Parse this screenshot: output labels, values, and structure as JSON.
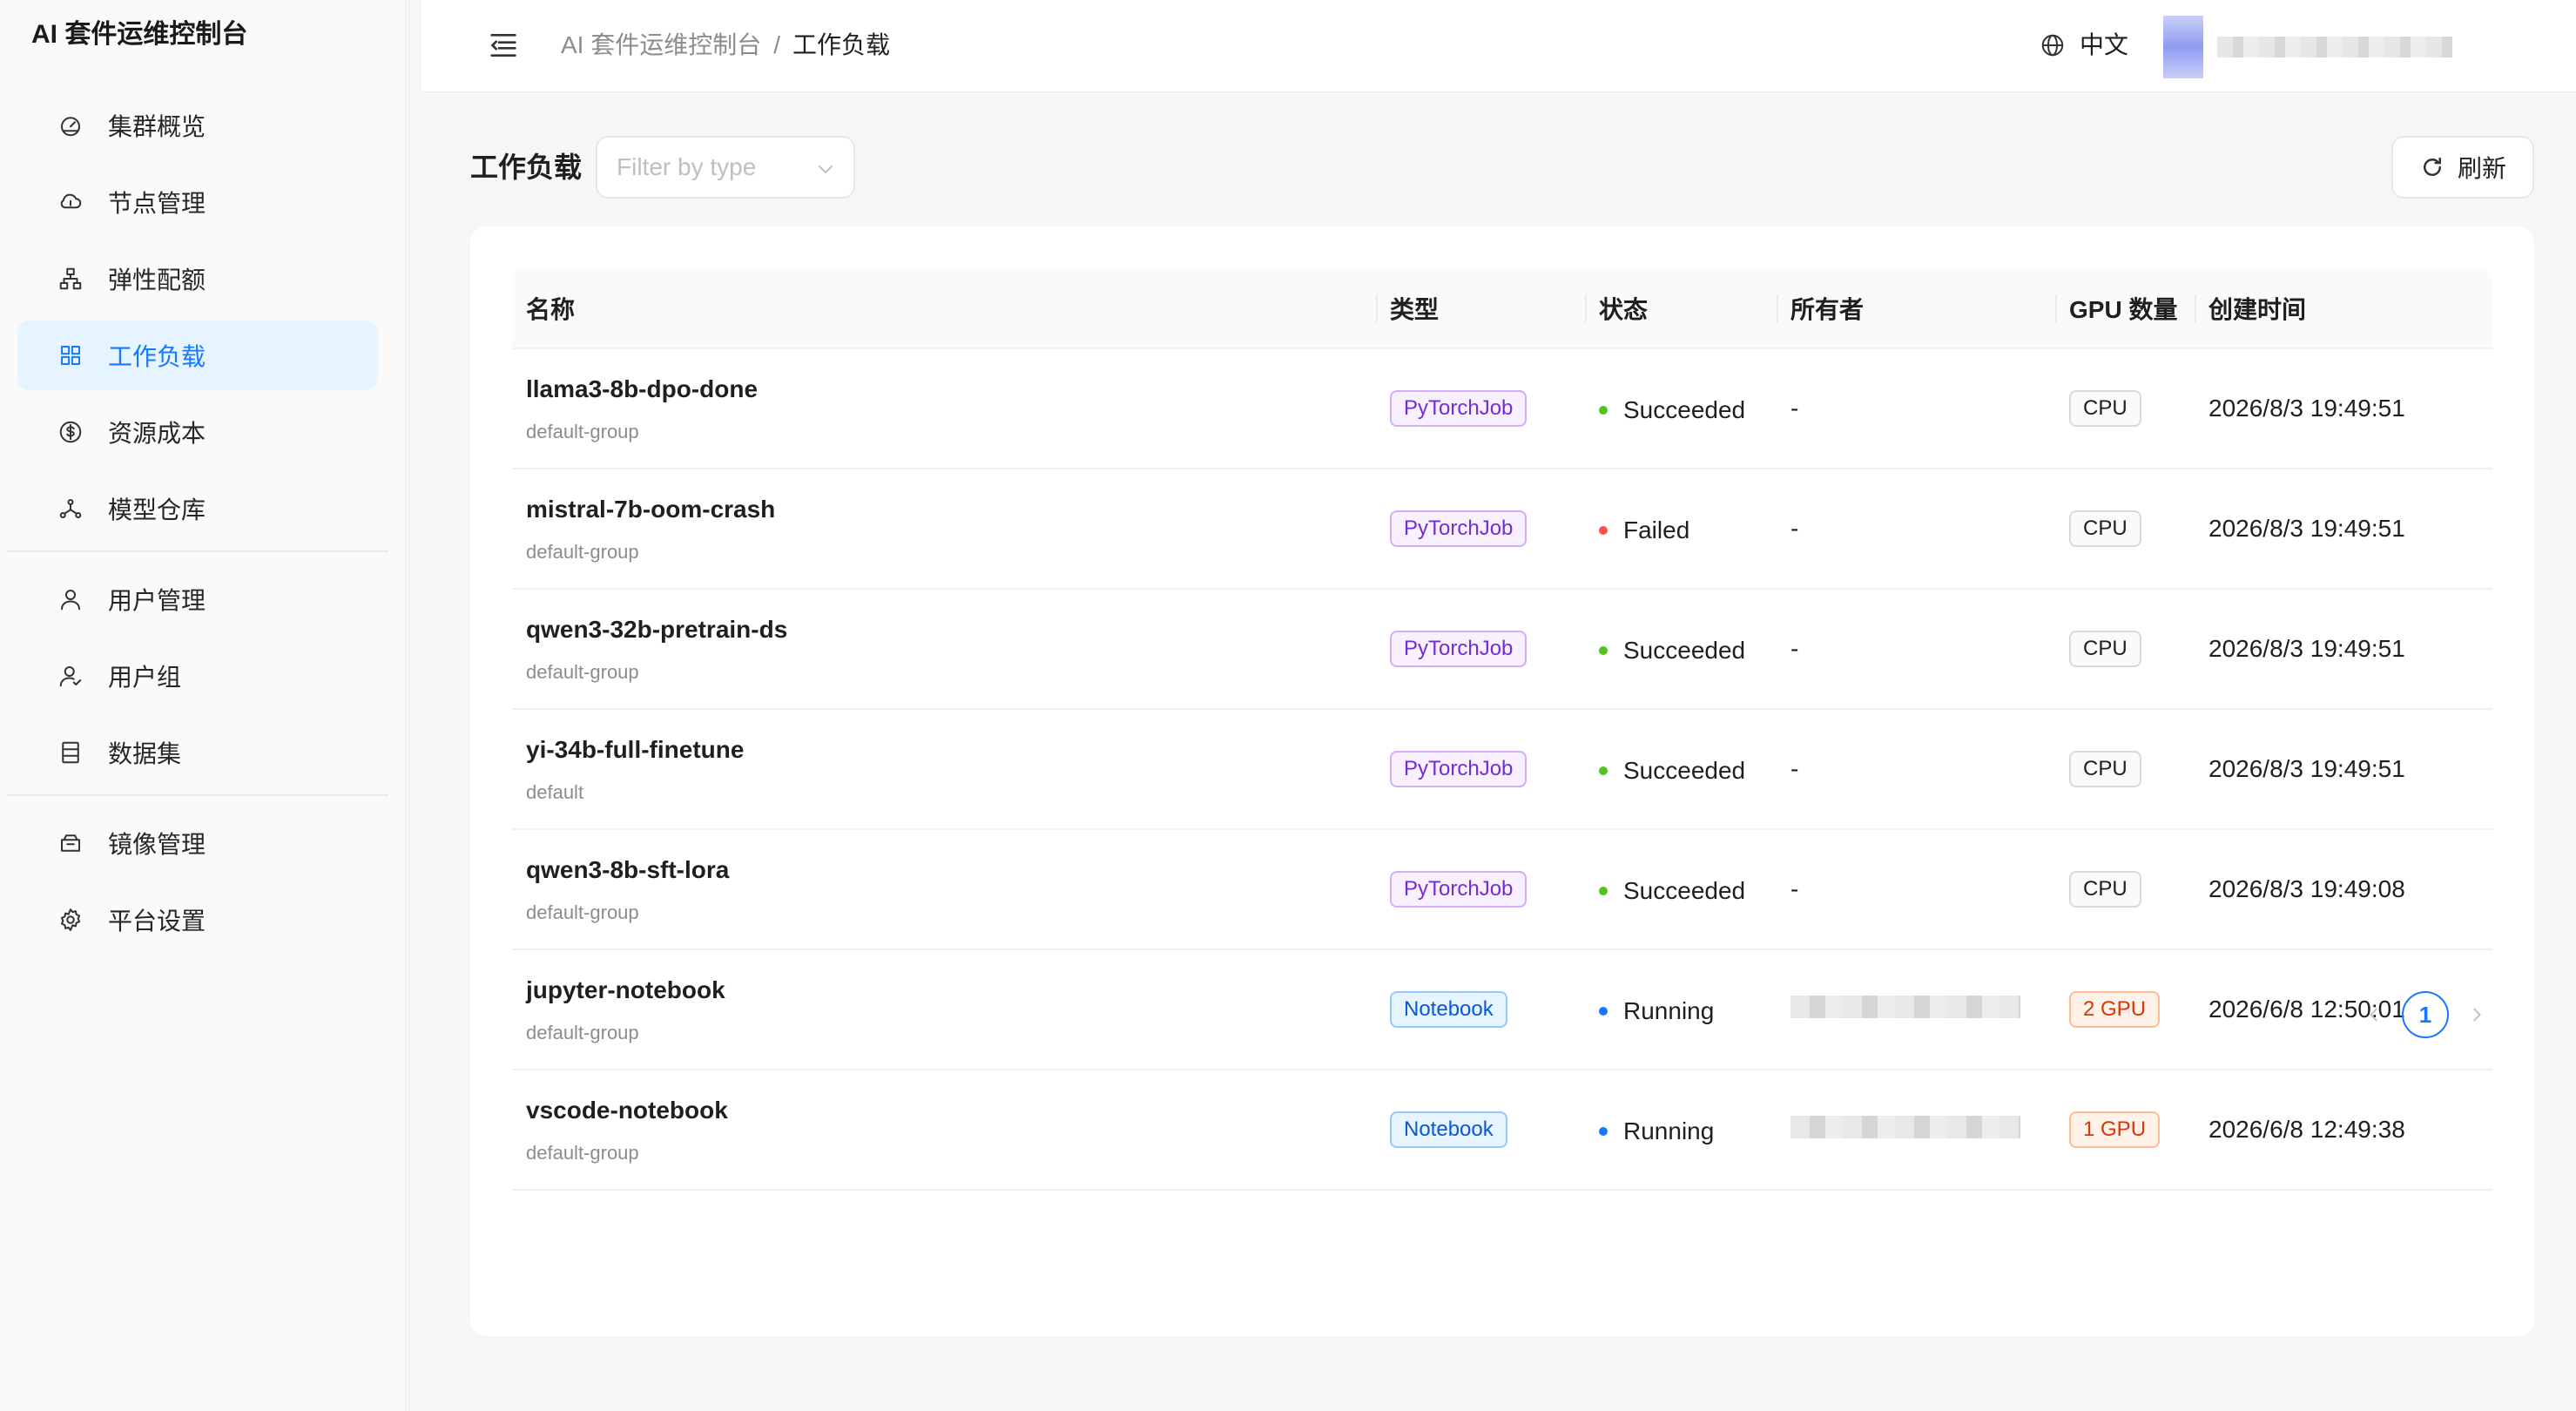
{
  "app": {
    "title": "AI 套件运维控制台"
  },
  "sidebar": {
    "groups": [
      [
        {
          "label": "集群概览",
          "icon": "dashboard-icon"
        },
        {
          "label": "节点管理",
          "icon": "cloud-icon"
        },
        {
          "label": "弹性配额",
          "icon": "hierarchy-icon"
        },
        {
          "label": "工作负载",
          "icon": "grid-icon",
          "active": true
        },
        {
          "label": "资源成本",
          "icon": "dollar-icon"
        },
        {
          "label": "模型仓库",
          "icon": "network-icon"
        }
      ],
      [
        {
          "label": "用户管理",
          "icon": "user-icon"
        },
        {
          "label": "用户组",
          "icon": "user-group-icon"
        },
        {
          "label": "数据集",
          "icon": "database-icon"
        }
      ],
      [
        {
          "label": "镜像管理",
          "icon": "box-icon"
        },
        {
          "label": "平台设置",
          "icon": "gear-icon"
        }
      ]
    ]
  },
  "header": {
    "breadcrumb": [
      "AI 套件运维控制台",
      "工作负载"
    ],
    "separator": "/",
    "language": "中文"
  },
  "toolbar": {
    "title": "工作负载",
    "filter_placeholder": "Filter by type",
    "refresh_label": "刷新"
  },
  "table": {
    "columns": [
      "名称",
      "类型",
      "状态",
      "所有者",
      "GPU 数量",
      "创建时间"
    ],
    "rows": [
      {
        "name": "llama3-8b-dpo-done",
        "group": "default-group",
        "type": "PyTorchJob",
        "status": "Succeeded",
        "owner": "-",
        "gpu": "CPU",
        "created": "2026/8/3 19:49:51"
      },
      {
        "name": "mistral-7b-oom-crash",
        "group": "default-group",
        "type": "PyTorchJob",
        "status": "Failed",
        "owner": "-",
        "gpu": "CPU",
        "created": "2026/8/3 19:49:51"
      },
      {
        "name": "qwen3-32b-pretrain-ds",
        "group": "default-group",
        "type": "PyTorchJob",
        "status": "Succeeded",
        "owner": "-",
        "gpu": "CPU",
        "created": "2026/8/3 19:49:51"
      },
      {
        "name": "yi-34b-full-finetune",
        "group": "default",
        "type": "PyTorchJob",
        "status": "Succeeded",
        "owner": "-",
        "gpu": "CPU",
        "created": "2026/8/3 19:49:51"
      },
      {
        "name": "qwen3-8b-sft-lora",
        "group": "default-group",
        "type": "PyTorchJob",
        "status": "Succeeded",
        "owner": "-",
        "gpu": "CPU",
        "created": "2026/8/3 19:49:08"
      },
      {
        "name": "jupyter-notebook",
        "group": "default-group",
        "type": "Notebook",
        "status": "Running",
        "owner": "",
        "gpu": "2 GPU",
        "created": "2026/6/8 12:50:01"
      },
      {
        "name": "vscode-notebook",
        "group": "default-group",
        "type": "Notebook",
        "status": "Running",
        "owner": "",
        "gpu": "1 GPU",
        "created": "2026/6/8 12:49:38"
      }
    ]
  },
  "pagination": {
    "current": "1"
  },
  "colors": {
    "accent": "#1677ff",
    "succeeded": "#52c41a",
    "failed": "#ff4d4f",
    "running": "#1677ff"
  }
}
